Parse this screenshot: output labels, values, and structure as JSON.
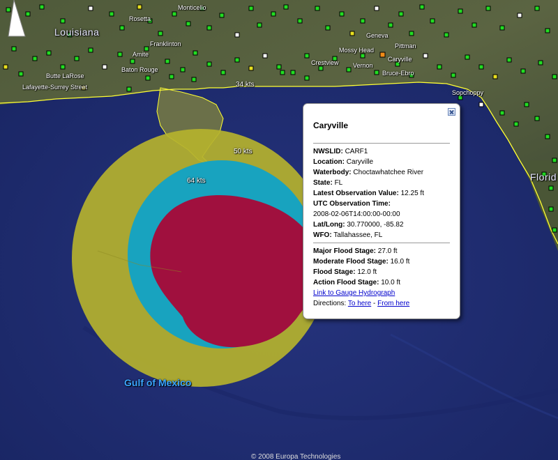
{
  "map": {
    "state_labels": [
      {
        "id": "louisiana",
        "text": "Louisiana"
      },
      {
        "id": "florida",
        "text": "Florid"
      }
    ],
    "water_label": "Gulf of Mexico",
    "places": [
      {
        "id": "monticello",
        "text": "Monticello"
      },
      {
        "id": "rosetta",
        "text": "Rosetta"
      },
      {
        "id": "franklinton",
        "text": "Franklinton"
      },
      {
        "id": "amite",
        "text": "Amite"
      },
      {
        "id": "baton-rouge",
        "text": "Baton Rouge"
      },
      {
        "id": "butte-larose",
        "text": "Butte LaRose"
      },
      {
        "id": "lafayette",
        "text": "Lafayette-Surrey Street"
      },
      {
        "id": "geneva",
        "text": "Geneva"
      },
      {
        "id": "pittman",
        "text": "Pittman"
      },
      {
        "id": "mossy-head",
        "text": "Mossy Head"
      },
      {
        "id": "caryville",
        "text": "Caryville"
      },
      {
        "id": "crestview",
        "text": "Crestview"
      },
      {
        "id": "vernon",
        "text": "Vernon"
      },
      {
        "id": "bruce-ebro",
        "text": "Bruce-Ebro"
      },
      {
        "id": "sopchoppy",
        "text": "Sopchoppy"
      }
    ],
    "wind_rings": [
      {
        "id": "34kts",
        "text": "34 kts",
        "color": "#b5b22e"
      },
      {
        "id": "50kts",
        "text": "50 kts",
        "color": "#18a3bf"
      },
      {
        "id": "64kts",
        "text": "64 kts",
        "color": "#a0103e"
      }
    ],
    "copyright": "© 2008 Europa Technologies"
  },
  "balloon": {
    "title": "Caryville",
    "fields": [
      {
        "key": "NWSLID:",
        "value": "CARF1"
      },
      {
        "key": "Location:",
        "value": "Caryville"
      },
      {
        "key": "Waterbody:",
        "value": "Choctawhatchee River"
      },
      {
        "key": "State:",
        "value": "FL"
      },
      {
        "key": "Latest Observation Value:",
        "value": "12.25 ft"
      }
    ],
    "utc_label": "UTC Observation Time:",
    "utc_value": "2008-02-06T14:00:00-00:00",
    "fields2": [
      {
        "key": "Lat/Long:",
        "value": "30.770000, -85.82"
      },
      {
        "key": "WFO:",
        "value": "Tallahassee, FL"
      }
    ],
    "stages": [
      {
        "key": "Major Flood Stage:",
        "value": "27.0 ft"
      },
      {
        "key": "Moderate Flood Stage:",
        "value": "16.0 ft"
      },
      {
        "key": "Flood Stage:",
        "value": "12.0 ft"
      },
      {
        "key": "Action Flood Stage:",
        "value": "10.0 ft"
      }
    ],
    "hydrograph_link": "Link to Gauge Hydrograph",
    "directions_label": "Directions:",
    "to_here": "To here",
    "separator": "-",
    "from_here": "From here"
  },
  "colors": {
    "gauge_normal": "#22dd22",
    "gauge_selected": "#f08c18",
    "gauge_action": "#e8e020",
    "gauge_none": "#ffffff",
    "coastline": "#ffff33"
  }
}
